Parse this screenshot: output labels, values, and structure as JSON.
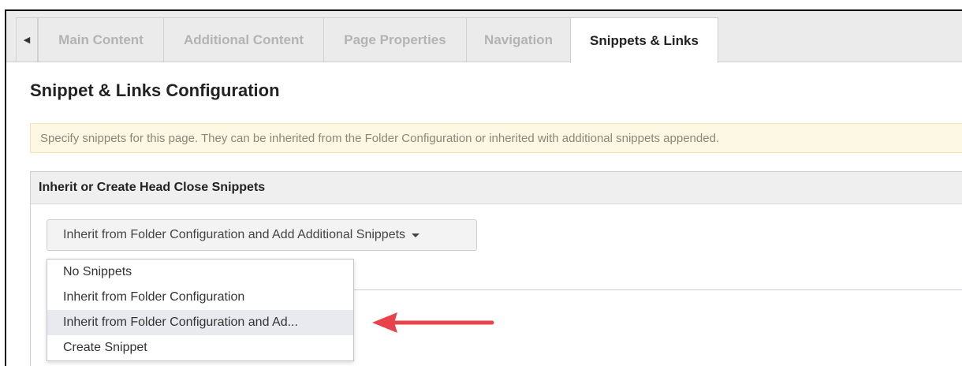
{
  "tabs": {
    "scroll_left_glyph": "◀",
    "items": [
      {
        "label": "Main Content"
      },
      {
        "label": "Additional Content"
      },
      {
        "label": "Page Properties"
      },
      {
        "label": "Navigation"
      },
      {
        "label": "Snippets & Links",
        "active": true
      }
    ]
  },
  "page": {
    "title": "Snippet & Links Configuration",
    "info_message": "Specify snippets for this page. They can be inherited from the Folder Configuration or inherited with additional snippets appended."
  },
  "panel": {
    "header": "Inherit or Create Head Close Snippets",
    "dropdown": {
      "selected": "Inherit from Folder Configuration and Add Additional Snippets",
      "options": [
        {
          "label": "No Snippets"
        },
        {
          "label": "Inherit from Folder Configuration"
        },
        {
          "label": "Inherit from Folder Configuration and Ad...",
          "highlighted": true
        },
        {
          "label": "Create Snippet"
        }
      ]
    }
  },
  "colors": {
    "annotation_arrow": "#e8434a",
    "info_banner_bg": "#fcf8e3",
    "highlighted_option_bg": "#e8eaef"
  },
  "icons": {
    "scroll_left": "triangle-left-icon",
    "dropdown_caret": "caret-down-icon"
  }
}
